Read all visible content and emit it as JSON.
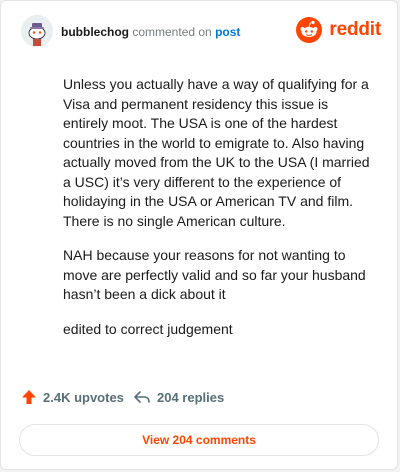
{
  "header": {
    "username": "bubblechog",
    "action_text": "commented on",
    "post_link": "post",
    "brand": "reddit"
  },
  "comment": {
    "paragraphs": [
      "Unless you actually have a way of qualifying for a Visa and permanent residency this issue is entirely moot. The USA is one of the hardest countries in the world to emigrate to. Also having actually moved from the UK to the USA (I married a USC) it’s very different to the experience of holidaying in the USA or American TV and film. There is no single American culture.",
      "NAH because your reasons for not wanting to move are perfectly valid and so far your husband hasn’t been a dick about it",
      "edited to correct judgement"
    ]
  },
  "actions": {
    "upvotes": "2.4K upvotes",
    "replies": "204 replies"
  },
  "footer": {
    "view_comments": "View 204 comments"
  },
  "colors": {
    "brand": "#ff4500",
    "link": "#0079d3"
  },
  "icons": {
    "avatar": "snoo-avatar",
    "brand": "reddit-logo",
    "upvote": "upvote-arrow-icon",
    "reply": "reply-arrow-icon"
  }
}
